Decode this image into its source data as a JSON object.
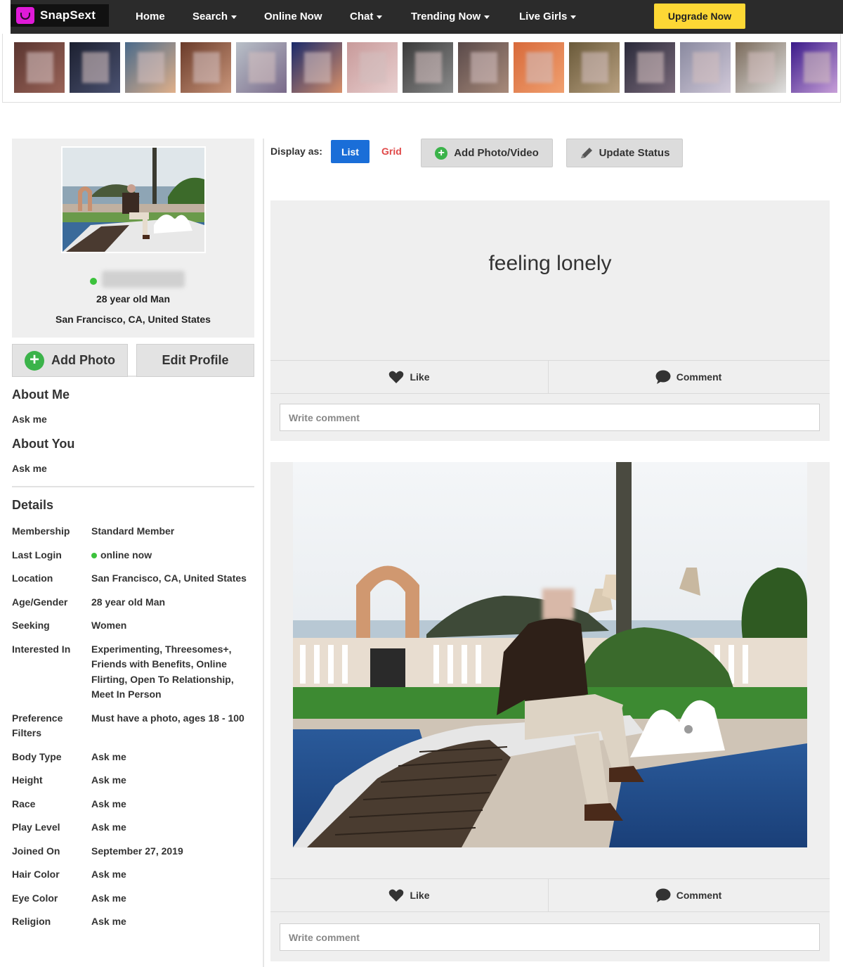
{
  "brand": {
    "name": "SnapSext",
    "logo_icon": "snapsext-logo-icon",
    "accent": "#e01ad8"
  },
  "nav": {
    "items": [
      {
        "label": "Home",
        "dropdown": false
      },
      {
        "label": "Search",
        "dropdown": true
      },
      {
        "label": "Online Now",
        "dropdown": false
      },
      {
        "label": "Chat",
        "dropdown": true
      },
      {
        "label": "Trending Now",
        "dropdown": true
      },
      {
        "label": "Live Girls",
        "dropdown": true
      }
    ],
    "upgrade_label": "Upgrade Now",
    "upgrade_color": "#fdd835"
  },
  "member_strip": {
    "count": 15,
    "note_icon": "member-thumbnail"
  },
  "profile": {
    "age_gender_line": "28 year old Man",
    "location_line": "San Francisco, CA, United States",
    "online_color": "#3cc23c"
  },
  "side_buttons": {
    "add_photo": "Add Photo",
    "edit_profile": "Edit Profile"
  },
  "about": {
    "about_me_title": "About Me",
    "about_me_text": "Ask me",
    "about_you_title": "About You",
    "about_you_text": "Ask me"
  },
  "details": {
    "title": "Details",
    "rows": [
      {
        "label": "Membership",
        "value": "Standard Member"
      },
      {
        "label": "Last Login",
        "value": "online now"
      },
      {
        "label": "Location",
        "value": "San Francisco, CA, United States"
      },
      {
        "label": "Age/Gender",
        "value": "28 year old Man"
      },
      {
        "label": "Seeking",
        "value": "Women"
      },
      {
        "label": "Interested In",
        "value": "Experimenting, Threesomes+, Friends with Benefits, Online Flirting, Open To Relationship, Meet In Person"
      },
      {
        "label": "Preference Filters",
        "value": "Must have a photo, ages 18 - 100"
      },
      {
        "label": "Body Type",
        "value": "Ask me"
      },
      {
        "label": "Height",
        "value": "Ask me"
      },
      {
        "label": "Race",
        "value": "Ask me"
      },
      {
        "label": "Play Level",
        "value": "Ask me"
      },
      {
        "label": "Joined On",
        "value": "September 27, 2019"
      },
      {
        "label": "Hair Color",
        "value": "Ask me"
      },
      {
        "label": "Eye Color",
        "value": "Ask me"
      },
      {
        "label": "Religion",
        "value": "Ask me"
      }
    ]
  },
  "toolbar": {
    "display_as": "Display as:",
    "list": "List",
    "grid": "Grid",
    "add_media": "Add Photo/Video",
    "update_status": "Update Status",
    "list_color": "#1a6ed8"
  },
  "posts": {
    "status": {
      "text": "feeling lonely",
      "like": "Like",
      "comment": "Comment",
      "comment_placeholder": "Write comment"
    },
    "photo": {
      "like": "Like",
      "comment": "Comment",
      "comment_placeholder": "Write comment"
    }
  }
}
